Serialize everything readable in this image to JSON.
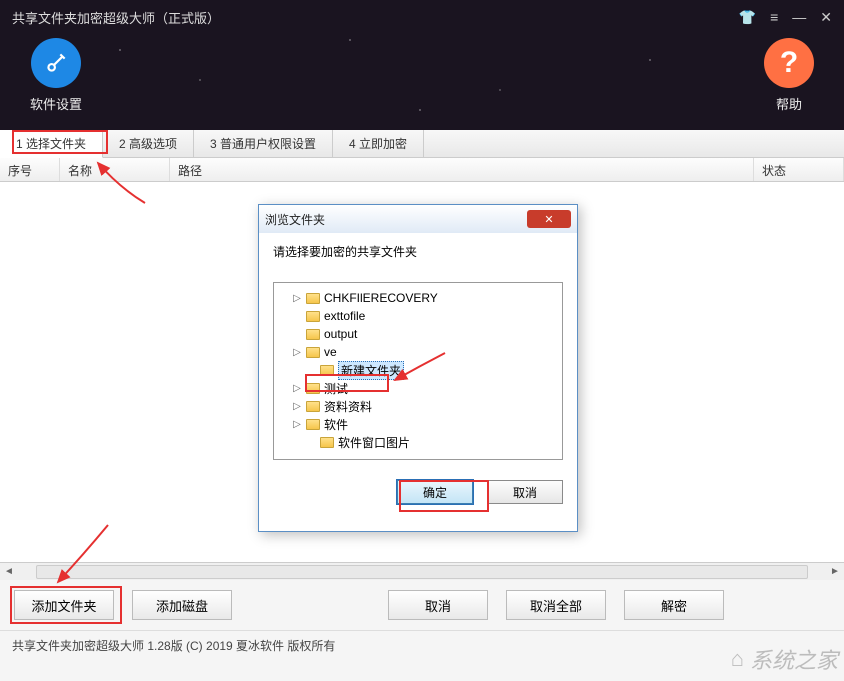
{
  "window": {
    "title": "共享文件夹加密超级大师（正式版）"
  },
  "topButtons": {
    "settings": "软件设置",
    "help": "帮助"
  },
  "tabs": [
    "1 选择文件夹",
    "2 高级选项",
    "3 普通用户权限设置",
    "4 立即加密"
  ],
  "columns": {
    "index": "序号",
    "name": "名称",
    "path": "路径",
    "status": "状态"
  },
  "bottomButtons": {
    "addFolder": "添加文件夹",
    "addDisk": "添加磁盘",
    "cancel": "取消",
    "cancelAll": "取消全部",
    "decrypt": "解密"
  },
  "statusBar": "共享文件夹加密超级大师  1.28版  (C) 2019 夏冰软件 版权所有",
  "dialog": {
    "title": "浏览文件夹",
    "prompt": "请选择要加密的共享文件夹",
    "tree": [
      {
        "indent": 1,
        "expander": "▷",
        "label": "CHKFIlERECOVERY"
      },
      {
        "indent": 1,
        "expander": "",
        "label": "exttofile"
      },
      {
        "indent": 1,
        "expander": "",
        "label": "output"
      },
      {
        "indent": 1,
        "expander": "▷",
        "label": "ve"
      },
      {
        "indent": 2,
        "expander": "",
        "label": "新建文件夹",
        "selected": true
      },
      {
        "indent": 1,
        "expander": "▷",
        "label": "测试"
      },
      {
        "indent": 1,
        "expander": "▷",
        "label": "资料资料"
      },
      {
        "indent": 1,
        "expander": "▷",
        "label": "软件"
      },
      {
        "indent": 2,
        "expander": "",
        "label": "软件窗口图片"
      }
    ],
    "ok": "确定",
    "cancel": "取消"
  },
  "watermark": "系统之家"
}
